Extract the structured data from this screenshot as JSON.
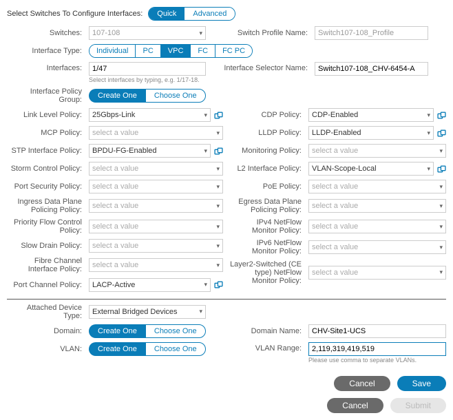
{
  "header": {
    "title": "Select Switches To Configure Interfaces:",
    "quick": "Quick",
    "advanced": "Advanced"
  },
  "switches_label": "Switches:",
  "switches_value": "107-108",
  "profile_label": "Switch Profile Name:",
  "profile_value": "Switch107-108_Profile",
  "iftype_label": "Interface Type:",
  "iftype": {
    "individual": "Individual",
    "pc": "PC",
    "vpc": "VPC",
    "fc": "FC",
    "fcpc": "FC PC"
  },
  "interfaces_label": "Interfaces:",
  "interfaces_value": "1/47",
  "interfaces_hint": "Select interfaces by typing, e.g. 1/17-18.",
  "ifsel_label": "Interface Selector Name:",
  "ifsel_value": "Switch107-108_CHV-6454-A",
  "ipg_label": "Interface Policy Group:",
  "create_one": "Create One",
  "choose_one": "Choose One",
  "placeholder": "select a value",
  "left_policies": {
    "link_level": {
      "label": "Link Level Policy:",
      "value": "25Gbps-Link"
    },
    "mcp": {
      "label": "MCP Policy:",
      "value": ""
    },
    "stp": {
      "label": "STP Interface Policy:",
      "value": "BPDU-FG-Enabled"
    },
    "storm": {
      "label": "Storm Control Policy:",
      "value": ""
    },
    "portsec": {
      "label": "Port Security Policy:",
      "value": ""
    },
    "ingress": {
      "label": "Ingress Data Plane Policing Policy:",
      "value": ""
    },
    "pfc": {
      "label": "Priority Flow Control Policy:",
      "value": ""
    },
    "slowdrain": {
      "label": "Slow Drain Policy:",
      "value": ""
    },
    "fc": {
      "label": "Fibre Channel Interface Policy:",
      "value": ""
    },
    "portchannel": {
      "label": "Port Channel Policy:",
      "value": "LACP-Active"
    }
  },
  "right_policies": {
    "cdp": {
      "label": "CDP Policy:",
      "value": "CDP-Enabled"
    },
    "lldp": {
      "label": "LLDP Policy:",
      "value": "LLDP-Enabled"
    },
    "monitoring": {
      "label": "Monitoring Policy:",
      "value": ""
    },
    "l2": {
      "label": "L2 Interface Policy:",
      "value": "VLAN-Scope-Local"
    },
    "poe": {
      "label": "PoE Policy:",
      "value": ""
    },
    "egress": {
      "label": "Egress Data Plane Policing Policy:",
      "value": ""
    },
    "ipv4nf": {
      "label": "IPv4 NetFlow Monitor Policy:",
      "value": ""
    },
    "ipv6nf": {
      "label": "IPv6 NetFlow Monitor Policy:",
      "value": ""
    },
    "l2nf": {
      "label": "Layer2-Switched (CE type) NetFlow Monitor Policy:",
      "value": ""
    }
  },
  "attached": {
    "devtype_label": "Attached Device Type:",
    "devtype_value": "External Bridged Devices",
    "domain_label": "Domain:",
    "vlan_label": "VLAN:",
    "domain_name_label": "Domain Name:",
    "domain_name_value": "CHV-Site1-UCS",
    "vlan_range_label": "VLAN Range:",
    "vlan_range_value": "2,119,319,419,519",
    "vlan_hint": "Please use comma to separate VLANs."
  },
  "buttons": {
    "cancel": "Cancel",
    "save": "Save",
    "submit": "Submit"
  }
}
